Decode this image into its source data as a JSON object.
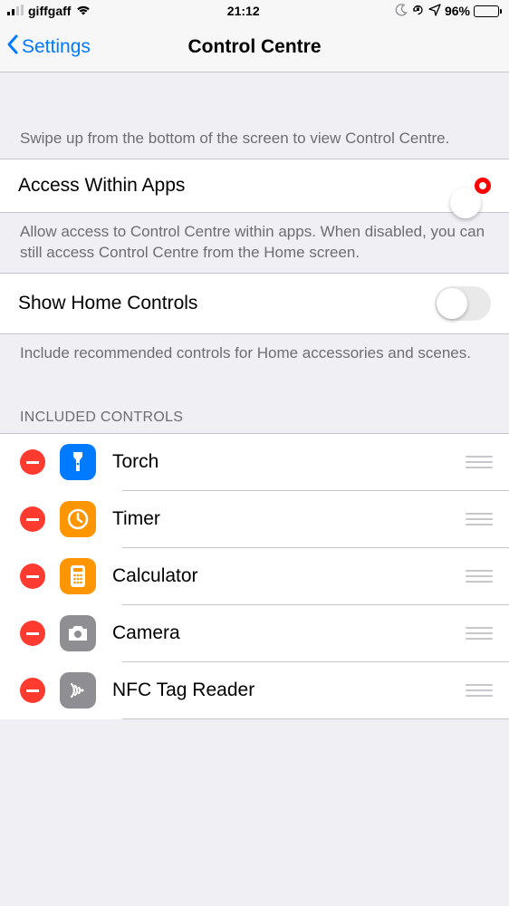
{
  "status_bar": {
    "carrier": "giffgaff",
    "time": "21:12",
    "battery_pct": "96%"
  },
  "nav": {
    "back_label": "Settings",
    "title": "Control Centre"
  },
  "sections": {
    "intro": "Swipe up from the bottom of the screen to view Control Centre.",
    "access_within_apps": {
      "label": "Access Within Apps",
      "on": true,
      "description": "Allow access to Control Centre within apps. When disabled, you can still access Control Centre from the Home screen."
    },
    "show_home_controls": {
      "label": "Show Home Controls",
      "on": false,
      "description": "Include recommended controls for Home accessories and scenes."
    },
    "included_header": "INCLUDED CONTROLS",
    "included": [
      {
        "name": "Torch",
        "icon": "torch",
        "color": "#007aff"
      },
      {
        "name": "Timer",
        "icon": "timer",
        "color": "#ff9500"
      },
      {
        "name": "Calculator",
        "icon": "calculator",
        "color": "#ff9500"
      },
      {
        "name": "Camera",
        "icon": "camera",
        "color": "#8e8e93"
      },
      {
        "name": "NFC Tag Reader",
        "icon": "nfc",
        "color": "#8e8e93"
      }
    ]
  }
}
